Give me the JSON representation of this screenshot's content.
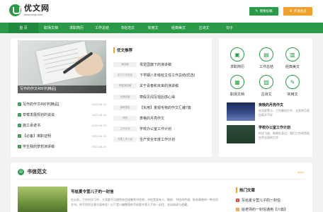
{
  "header": {
    "logo_name": "优文网",
    "logo_url": "www.smjs.com",
    "btn_submit": "我要投稿",
    "btn_vip": "开通会员"
  },
  "nav": [
    "首 页",
    "职场文档",
    "求职简历",
    "工作总结",
    "书信范文",
    "实用文",
    "经典美文",
    "古诗文",
    "句子"
  ],
  "featured": {
    "caption": "写作的作文400字[精品]"
  },
  "left_list": [
    {
      "title": "写作的作文400字[精品]",
      "date": "2023-06-19"
    },
    {
      "title": "草莓发展规划的说说",
      "date": "2023-06-19"
    },
    {
      "title": "施工承诺书",
      "date": "2023-06-19"
    },
    {
      "title": "【必备】离职证明",
      "date": "2023-06-19"
    },
    {
      "title": "学生我的梦想演讲稿",
      "date": "2023-06-19"
    }
  ],
  "recommend": {
    "title": "优文推荐",
    "items": [
      {
        "tag": "演讲稿",
        "title": "母爱国旗下的演讲稿"
      },
      {
        "tag": "实习工作总结",
        "title": "下学期八年级班主任工作总结(优选)"
      },
      {
        "tag": "青春演讲稿",
        "title": "关于青春和未来的演讲稿"
      },
      {
        "tag": "优美段落",
        "title": "寒假见闻写观后感心得"
      },
      {
        "tag": "调研报告",
        "title": "【实用】景观毛物的作文汇编7篇"
      },
      {
        "tag": "求职",
        "title": "表格的月亮作文"
      },
      {
        "tag": "工作计划",
        "title": "学校办公室工作计划"
      },
      {
        "tag": "开展工作计划",
        "title": "生产安全年度工作计划"
      }
    ]
  },
  "categories": [
    {
      "icon": "briefcase-icon",
      "label": "求职简历",
      "glyph": "▣"
    },
    {
      "icon": "document-icon",
      "label": "工作总结",
      "glyph": "▤"
    },
    {
      "icon": "book-icon",
      "label": "经典美文",
      "glyph": "▥"
    },
    {
      "icon": "folder-icon",
      "label": "职场文档",
      "glyph": "▦"
    },
    {
      "icon": "scroll-icon",
      "label": "古诗文",
      "glyph": "▧"
    },
    {
      "icon": "pen-icon",
      "label": "实用文",
      "glyph": "✎"
    }
  ],
  "side_articles": [
    {
      "title": "夜晚的月亮作文",
      "desc": "在回家等方，工作都在忙中，太家的月亮由离开不好"
    },
    {
      "title": "学校办公室工作计划",
      "desc": "时光飞逝，新周在身边，我们工作经验现在积全面的工作"
    }
  ],
  "section": {
    "title": "书信范文",
    "more": "more",
    "article_title": "写给夏令营儿子的一封信",
    "article_desc": "在从前，工作时学习中，大家都不可避免地会接触到书信吧，书信是具有人、眼前、书信间传递。联系事物的一种应用文书。你写信时注意方面有些？以下是小编整理的写给夏令营儿子的一封信，欢迎阅读与收藏。"
  },
  "hot": {
    "title": "热门文章",
    "items": [
      "写给夏令营儿子的一封信",
      "给老师的一封信通用【六篇】"
    ]
  },
  "colors": {
    "brand_green": "#2a9a48",
    "accent_orange": "#f0a12b",
    "hot_red": "#e5472c"
  }
}
